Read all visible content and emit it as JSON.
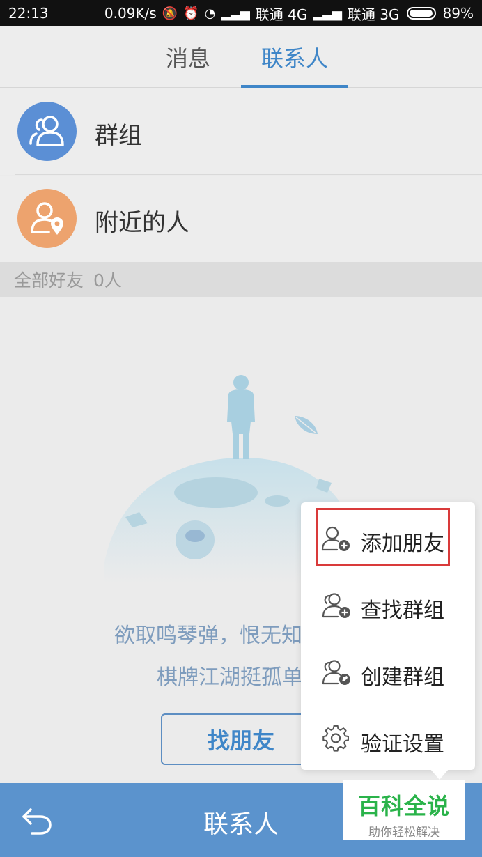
{
  "status_bar": {
    "time": "22:13",
    "speed": "0.09K/s",
    "carrier1": "联通 4G",
    "carrier2": "联通 3G",
    "battery": "89%"
  },
  "tabs": [
    {
      "label": "消息",
      "active": false
    },
    {
      "label": "联系人",
      "active": true
    }
  ],
  "rows": {
    "groups": "群组",
    "nearby": "附近的人"
  },
  "section_header": {
    "label": "全部好友",
    "count": "0人"
  },
  "empty_state": {
    "line1": "欲取鸣琴弹，恨无知",
    "line2": "棋牌江湖挺孤单",
    "button": "找朋友"
  },
  "popup_menu": {
    "items": [
      {
        "label": "添加朋友",
        "icon": "add-user-icon",
        "highlighted": true
      },
      {
        "label": "查找群组",
        "icon": "search-group-icon",
        "highlighted": false
      },
      {
        "label": "创建群组",
        "icon": "create-group-icon",
        "highlighted": false
      },
      {
        "label": "验证设置",
        "icon": "gear-icon",
        "highlighted": false
      }
    ]
  },
  "bottom_bar": {
    "title": "联系人"
  },
  "watermark": {
    "title": "百科全说",
    "subtitle": "助你轻松解决"
  },
  "colors": {
    "accent": "#3f86c8",
    "bottom_bar": "#5b93cd",
    "highlight": "#d93a3a",
    "group_avatar": "#5b8fd5",
    "nearby_avatar": "#eda36e"
  }
}
